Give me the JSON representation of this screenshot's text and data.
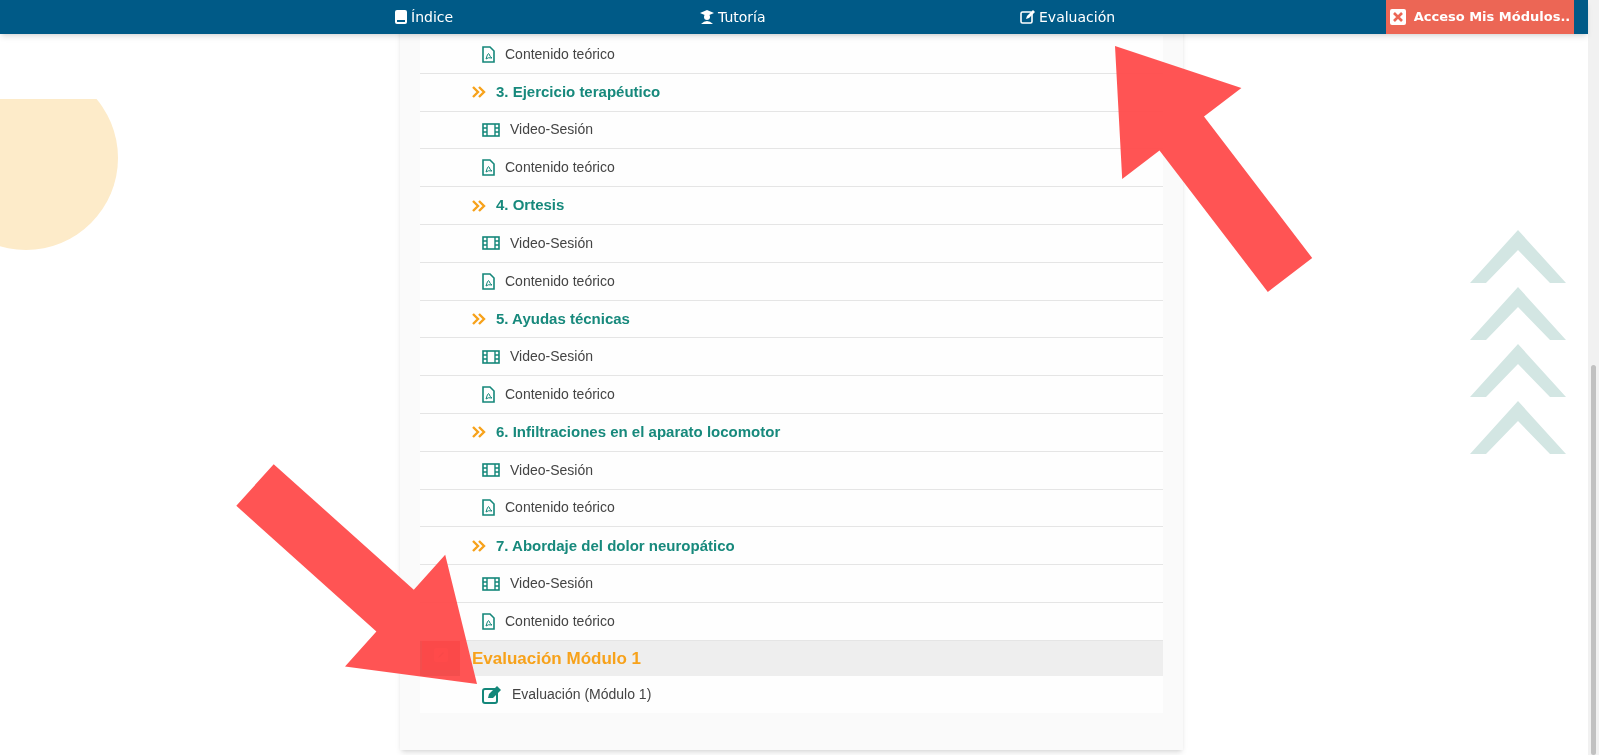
{
  "nav": {
    "items": [
      {
        "label": "Índice"
      },
      {
        "label": "Tutoría"
      },
      {
        "label": "Evaluación"
      }
    ],
    "modules_button": {
      "label": "Acceso Mis Módulos.."
    }
  },
  "course_index": {
    "rows": [
      {
        "kind": "pdf",
        "label": "Contenido teórico"
      },
      {
        "kind": "section",
        "label": "3. Ejercicio terapéutico"
      },
      {
        "kind": "video",
        "label": "Video-Sesión"
      },
      {
        "kind": "pdf",
        "label": "Contenido teórico"
      },
      {
        "kind": "section",
        "label": "4. Ortesis"
      },
      {
        "kind": "video",
        "label": "Video-Sesión"
      },
      {
        "kind": "pdf",
        "label": "Contenido teórico"
      },
      {
        "kind": "section",
        "label": "5. Ayudas técnicas"
      },
      {
        "kind": "video",
        "label": "Video-Sesión"
      },
      {
        "kind": "pdf",
        "label": "Contenido teórico"
      },
      {
        "kind": "section",
        "label": "6. Infiltraciones en el aparato locomotor"
      },
      {
        "kind": "video",
        "label": "Video-Sesión"
      },
      {
        "kind": "pdf",
        "label": "Contenido teórico"
      },
      {
        "kind": "section",
        "label": "7. Abordaje del dolor neuropático"
      },
      {
        "kind": "video",
        "label": "Video-Sesión"
      },
      {
        "kind": "pdf",
        "label": "Contenido teórico"
      }
    ]
  },
  "evaluation": {
    "title": "Evaluación Módulo 1",
    "items": [
      {
        "label": "Evaluación (Módulo 1)"
      }
    ]
  }
}
